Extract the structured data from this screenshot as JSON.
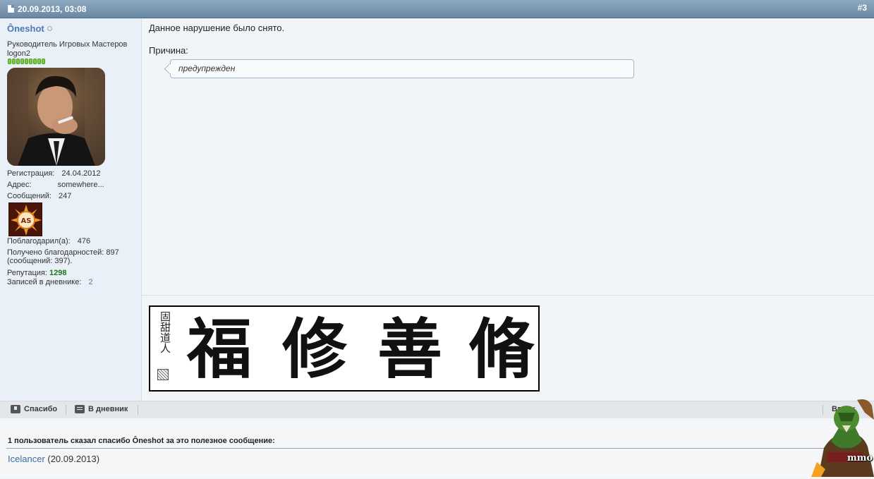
{
  "header": {
    "date": "20.09.2013, 03:08",
    "post_number": "#3"
  },
  "user": {
    "name": "Ôneshot",
    "title_line1": "Руководитель Игровых Мастеров",
    "title_line2": "logon2",
    "rank_pips": 9,
    "fields": {
      "registration_label": "Регистрация:",
      "registration_value": "24.04.2012",
      "address_label": "Адрес:",
      "address_value": "somewhere...",
      "messages_label": "Сообщений:",
      "messages_value": "247",
      "thanked_label": "Поблагодарил(а):",
      "thanked_value": "476",
      "received_text_1": "Получено благодарностей: 897",
      "received_text_2": "(сообщений: 397).",
      "reputation_label": "Репутация:",
      "reputation_value": "1298",
      "blog_label": "Записей в дневнике:",
      "blog_value": "2"
    },
    "award_logo_text": "AS"
  },
  "post": {
    "message": "Данное нарушение было снято.",
    "reason_label": "Причина:",
    "reason_text": "предупрежден"
  },
  "signature": {
    "seal_text": "固甜道人",
    "characters": [
      "福",
      "修",
      "善",
      "脩"
    ]
  },
  "actions": {
    "thanks_label": "Спасибо",
    "blog_label": "В дневник",
    "top_label": "Вверх"
  },
  "thanks": {
    "title": "1 пользователь сказал спасибо Ôneshot за это полезное сообщение:",
    "user": "Icelancer",
    "date": "(20.09.2013)"
  },
  "mascot": {
    "logo_text": "mmo"
  },
  "colors": {
    "header_bg": "#7894ae",
    "username": "#4b79b6",
    "reputation": "#1d7a14",
    "sidebar_bg": "#e9f0f7",
    "link": "#3d6e9e"
  }
}
